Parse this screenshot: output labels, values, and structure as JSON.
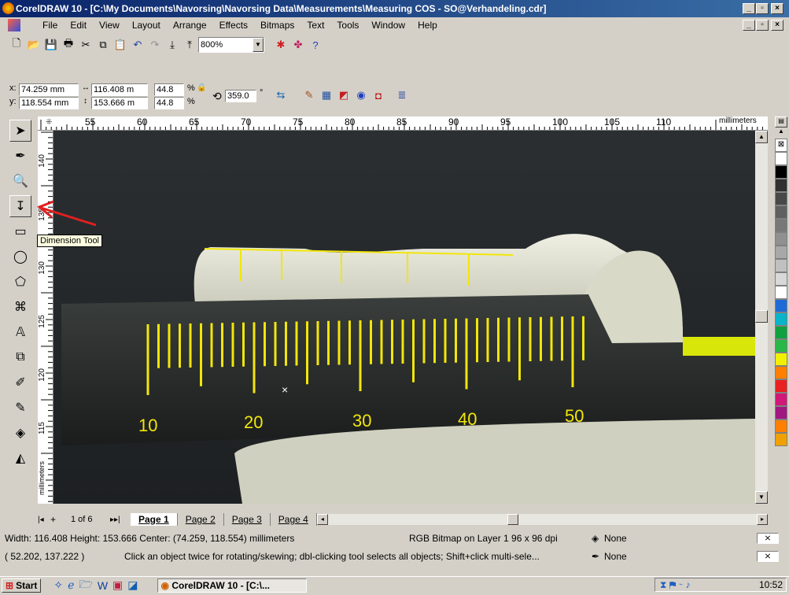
{
  "window": {
    "title": "CorelDRAW 10 - [C:\\My Documents\\Navorsing\\Navorsing Data\\Measurements\\Measuring COS - SO@Verhandeling.cdr]",
    "min_label": "_",
    "max_label": "▫",
    "close_label": "×"
  },
  "menu": {
    "items": [
      "File",
      "Edit",
      "View",
      "Layout",
      "Arrange",
      "Effects",
      "Bitmaps",
      "Text",
      "Tools",
      "Window",
      "Help"
    ]
  },
  "toolbar": {
    "zoom_value": "800%"
  },
  "property_bar": {
    "x_label": "x:",
    "x_value": "74.259 mm",
    "y_label": "y:",
    "y_value": "118.554 mm",
    "width_value": "116.408 m",
    "height_value": "153.666 m",
    "scale_x": "44.8",
    "scale_y": "44.8",
    "pct1": "%",
    "pct2": "%",
    "rotation_value": "359.0",
    "degree_label": "°"
  },
  "ruler_top": {
    "ticks": [
      "55",
      "60",
      "65",
      "70",
      "75",
      "80",
      "85",
      "90",
      "95",
      "100",
      "105",
      "110"
    ],
    "unit": "millimeters"
  },
  "ruler_left": {
    "ticks": [
      "140",
      "135",
      "130",
      "125",
      "120",
      "115"
    ],
    "unit": "millimeters"
  },
  "tooltip": {
    "text": "Dimension Tool"
  },
  "pages": {
    "counter": "1 of 6",
    "tabs": [
      "Page 1",
      "Page 2",
      "Page 3",
      "Page 4"
    ]
  },
  "status": {
    "line1": "Width: 116.408  Height: 153.666  Center: (74.259, 118.554)  millimeters",
    "object_info": "RGB Bitmap on Layer 1 96 x 96 dpi",
    "fill": "None",
    "line2": "( 52.202, 137.222 )",
    "hint": "Click an object twice for rotating/skewing; dbl-clicking tool selects all objects; Shift+click multi-sele...",
    "outline": "None"
  },
  "taskbar": {
    "start": "Start",
    "task": "CorelDRAW 10 - [C:\\...",
    "clock": "10:52"
  },
  "scale_labels": [
    "10",
    "20",
    "30",
    "40",
    "50"
  ],
  "colors": {
    "title_bar": "#0a246a",
    "measure_yellow": "#f2e60a",
    "arrow_red": "#e02020"
  },
  "palette": [
    "#ffffff",
    "#000000",
    "#303030",
    "#484848",
    "#606060",
    "#787878",
    "#909090",
    "#a8a8a8",
    "#c0c0c0",
    "#d8d8d8",
    "#ffffff",
    "#1e6bd8",
    "#0ab4c8",
    "#10a040",
    "#28b848",
    "#f0f000",
    "#ff8000",
    "#e82020",
    "#d01878",
    "#a01880",
    "#ff8000",
    "#f0a000"
  ]
}
